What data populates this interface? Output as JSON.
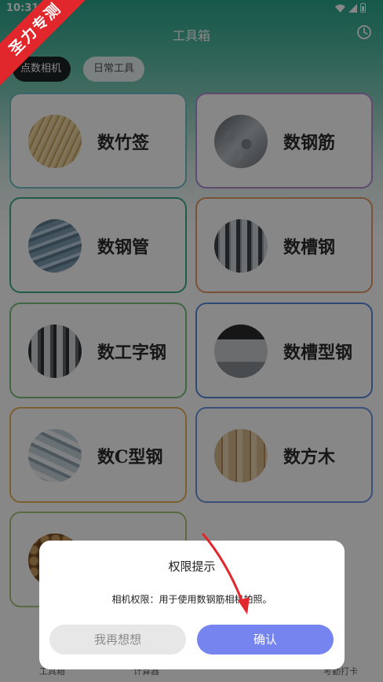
{
  "status_bar": {
    "time": "10:31"
  },
  "header": {
    "title": "工具箱"
  },
  "tabs": [
    {
      "label": "点数相机",
      "active": true
    },
    {
      "label": "日常工具",
      "active": false
    }
  ],
  "cards": [
    {
      "label": "数竹签",
      "image": "bamboo-sticks"
    },
    {
      "label": "数钢筋",
      "image": "steel-rebar"
    },
    {
      "label": "数钢管",
      "image": "steel-pipes"
    },
    {
      "label": "数槽钢",
      "image": "channel-steel"
    },
    {
      "label": "数工字钢",
      "image": "i-beam-steel"
    },
    {
      "label": "数槽型钢",
      "image": "channel-profile-steel"
    },
    {
      "label": "数C型钢",
      "image": "c-channel-steel"
    },
    {
      "label": "数方木",
      "image": "square-timber"
    },
    {
      "label": "",
      "image": "round-logs"
    }
  ],
  "bottom_nav": [
    {
      "label": "工具箱"
    },
    {
      "label": "计算器"
    },
    {
      "label": "考勤打卡"
    }
  ],
  "dialog": {
    "title": "权限提示",
    "message": "相机权限：用于使用数钢筋相机拍照。",
    "cancel_label": "我再想想",
    "confirm_label": "确认"
  },
  "watermark": {
    "text": "圣力专测"
  },
  "colors": {
    "confirm_button": "#7584ee",
    "header_gradient_top": "#2aa78d",
    "watermark_red": "#e1262c",
    "arrow_red": "#e1262c"
  }
}
